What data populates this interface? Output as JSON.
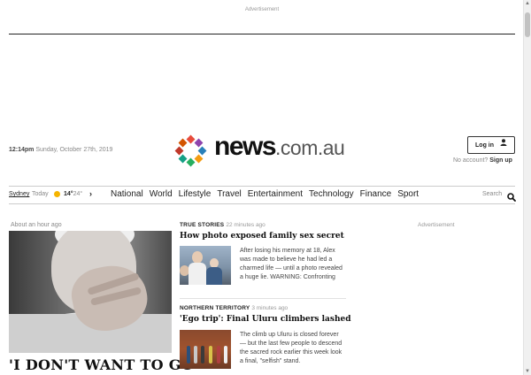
{
  "ad_top_label": "Advertisement",
  "header": {
    "time": "12:14pm",
    "date": "Sunday, October 27th, 2019",
    "logo_main": "news",
    "logo_suffix": ".com.au",
    "login_label": "Log in",
    "no_account_text": "No account?",
    "signup_label": "Sign up"
  },
  "logo_colors": [
    "#e74c3c",
    "#8e44ad",
    "#2980b9",
    "#f39c12",
    "#27ae60",
    "#16a085",
    "#c0392b",
    "#d35400"
  ],
  "weather": {
    "city": "Sydney",
    "day": "Today",
    "low": "14°",
    "high": "24°",
    "icon": "sun-icon"
  },
  "nav": {
    "items": [
      "National",
      "World",
      "Lifestyle",
      "Travel",
      "Entertainment",
      "Technology",
      "Finance",
      "Sport"
    ],
    "search_label": "Search"
  },
  "lead": {
    "time_ago": "About an hour ago",
    "headline": "'I DON'T WANT TO GO"
  },
  "stories": [
    {
      "kicker": "TRUE STORIES",
      "time_ago": "22 minutes ago",
      "headline": "How photo exposed family sex secret",
      "summary": "After losing his memory at 18, Alex was made to believe he had led a charmed life — until a photo revealed a huge lie. WARNING: Confronting"
    },
    {
      "kicker": "NORTHERN TERRITORY",
      "time_ago": "3 minutes ago",
      "headline": "'Ego trip': Final Uluru climbers lashed",
      "summary": "The climb up Uluru is closed forever — but the last few people to descend the sacred rock earlier this week look a final, \"selfish\" stand."
    }
  ],
  "ad_right_label": "Advertisement"
}
